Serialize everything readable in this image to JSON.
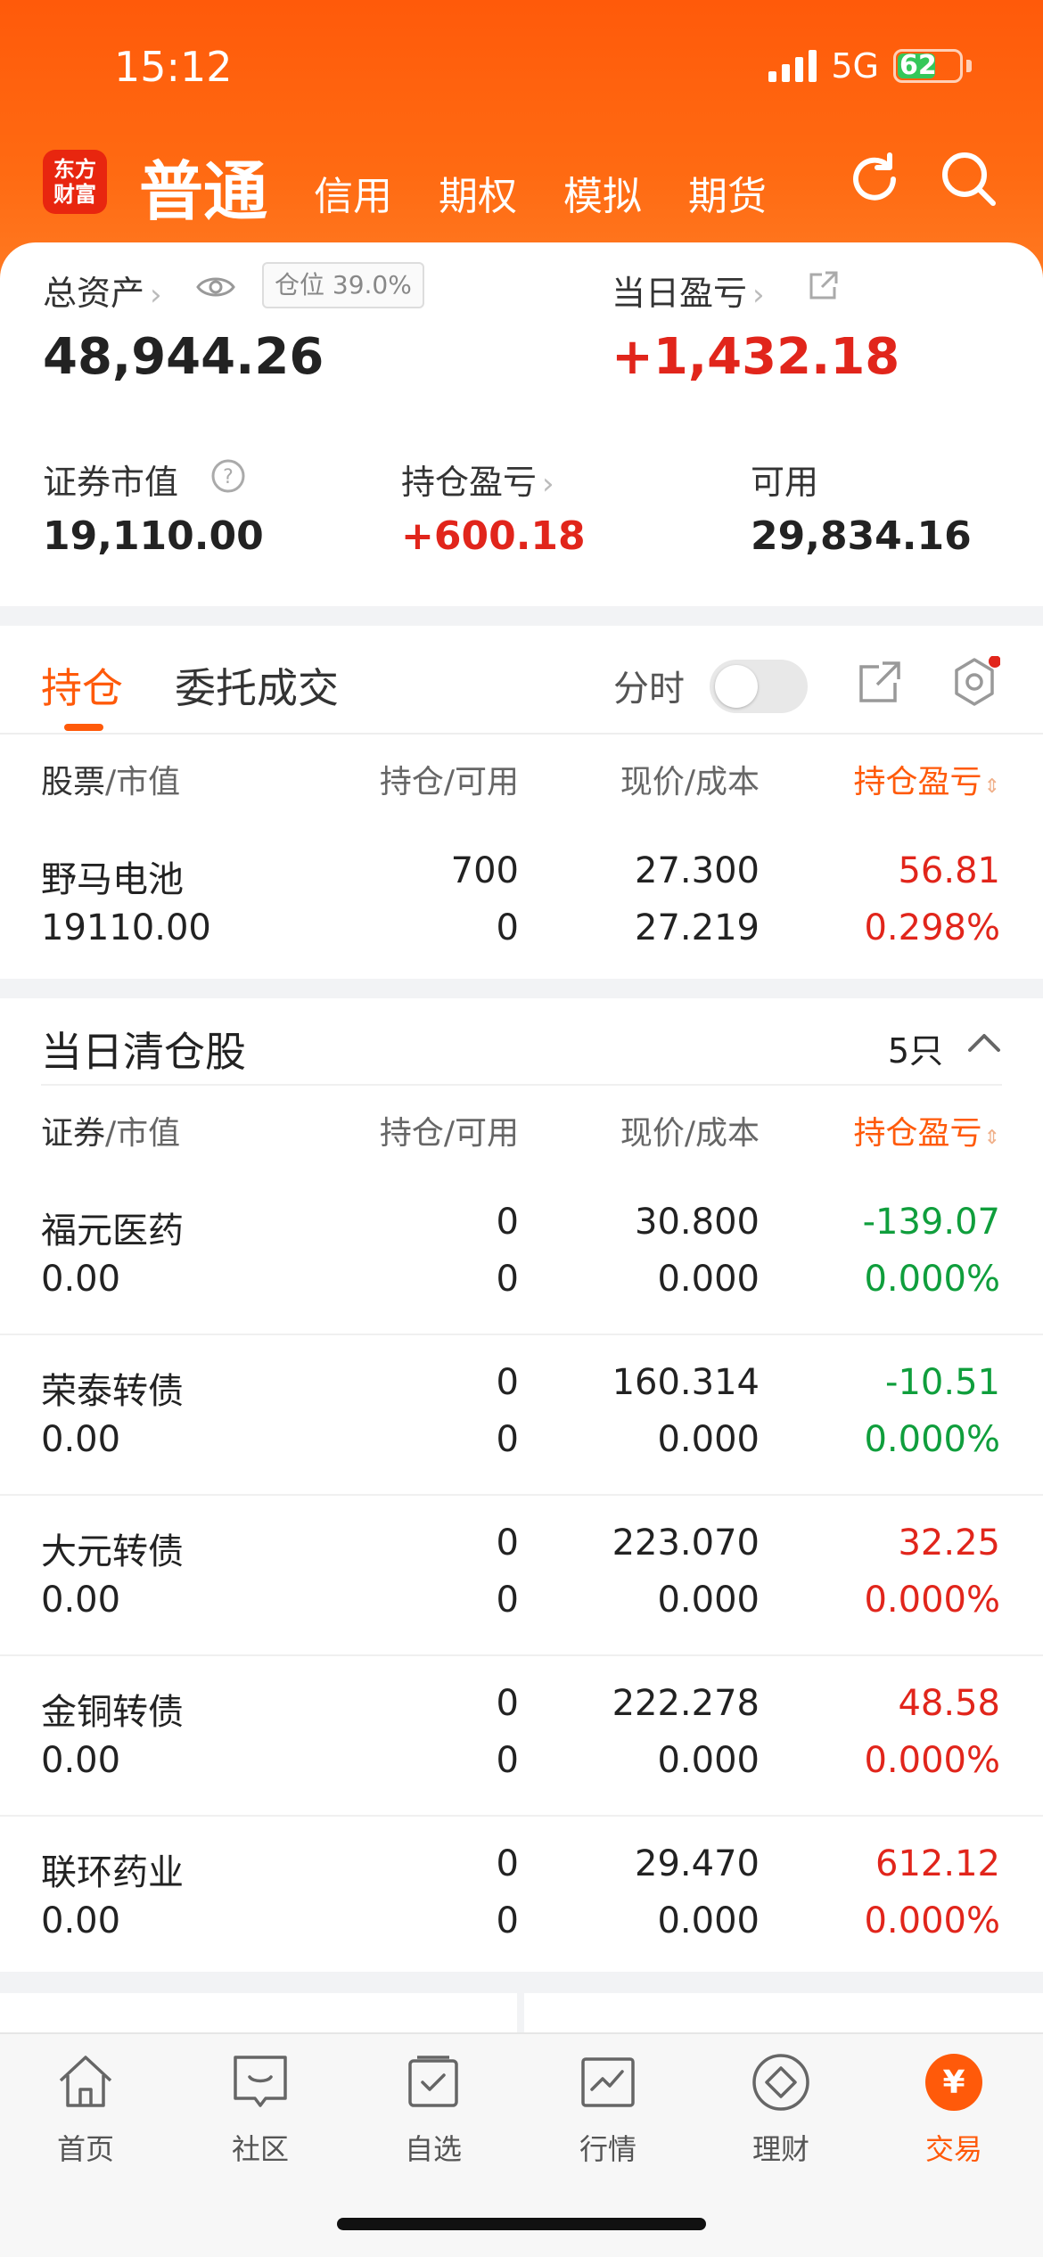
{
  "status": {
    "time": "15:12",
    "network": "5G",
    "battery": "62",
    "battery_level": 0.62
  },
  "header": {
    "logo_line1": "东方",
    "logo_line2": "财富",
    "mode_active": "普通",
    "modes": [
      "信用",
      "期权",
      "模拟",
      "期货"
    ]
  },
  "assets": {
    "total_label": "总资产",
    "position_badge": "仓位 39.0%",
    "total_value": "48,944.26",
    "daily_pl_label": "当日盈亏",
    "daily_pl_value": "+1,432.18",
    "sec_value_label": "证券市值",
    "sec_value": "19,110.00",
    "hold_pl_label": "持仓盈亏",
    "hold_pl_value": "+600.18",
    "avail_label": "可用",
    "avail_value": "29,834.16"
  },
  "holdings": {
    "tabs": [
      "持仓",
      "委托成交"
    ],
    "time_share_label": "分时",
    "columns": [
      "股票",
      "/市值",
      "持仓",
      "/可用",
      "现价",
      "/成本",
      "持仓盈亏"
    ],
    "rows": [
      {
        "name": "野马电池",
        "mv": "19110.00",
        "pos": "700",
        "avail": "0",
        "price": "27.300",
        "cost": "27.219",
        "pl": "56.81",
        "pl_pct": "0.298%",
        "dir": "up"
      }
    ]
  },
  "cleared": {
    "title": "当日清仓股",
    "count": "5只",
    "columns": [
      "证券",
      "/市值",
      "持仓",
      "/可用",
      "现价",
      "/成本",
      "持仓盈亏"
    ],
    "rows": [
      {
        "name": "福元医药",
        "mv": "0.00",
        "pos": "0",
        "avail": "0",
        "price": "30.800",
        "cost": "0.000",
        "pl": "-139.07",
        "pl_pct": "0.000%",
        "dir": "down"
      },
      {
        "name": "荣泰转债",
        "mv": "0.00",
        "pos": "0",
        "avail": "0",
        "price": "160.314",
        "cost": "0.000",
        "pl": "-10.51",
        "pl_pct": "0.000%",
        "dir": "down"
      },
      {
        "name": "大元转债",
        "mv": "0.00",
        "pos": "0",
        "avail": "0",
        "price": "223.070",
        "cost": "0.000",
        "pl": "32.25",
        "pl_pct": "0.000%",
        "dir": "up"
      },
      {
        "name": "金铜转债",
        "mv": "0.00",
        "pos": "0",
        "avail": "0",
        "price": "222.278",
        "cost": "0.000",
        "pl": "48.58",
        "pl_pct": "0.000%",
        "dir": "up"
      },
      {
        "name": "联环药业",
        "mv": "0.00",
        "pos": "0",
        "avail": "0",
        "price": "29.470",
        "cost": "0.000",
        "pl": "612.12",
        "pl_pct": "0.000%",
        "dir": "up"
      }
    ]
  },
  "nav": {
    "items": [
      "首页",
      "社区",
      "自选",
      "行情",
      "理财",
      "交易"
    ],
    "active_index": 5,
    "trade_symbol": "¥"
  },
  "colors": {
    "brand": "#ff5a0a",
    "up": "#e1251b",
    "down": "#0f9e3c"
  }
}
